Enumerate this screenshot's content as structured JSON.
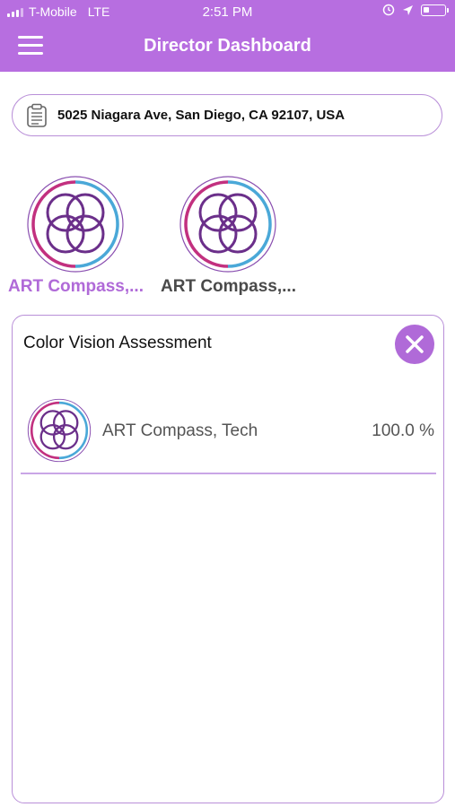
{
  "status_bar": {
    "carrier": "T-Mobile",
    "network": "LTE",
    "time": "2:51 PM",
    "icons": [
      "signal-icon",
      "alarm-icon",
      "location-icon",
      "battery-icon"
    ]
  },
  "header": {
    "title": "Director Dashboard",
    "menu_icon": "hamburger-menu-icon",
    "background_color": "#b76ee0"
  },
  "address": {
    "text": "5025 Niagara Ave, San Diego, CA 92107, USA",
    "icon": "clipboard-icon"
  },
  "entities": [
    {
      "label": "ART Compass,...",
      "selected": true,
      "icon": "art-compass-logo-icon"
    },
    {
      "label": "ART Compass,...",
      "selected": false,
      "icon": "art-compass-logo-icon"
    }
  ],
  "panel": {
    "title": "Color Vision Assessment",
    "close_icon": "close-icon",
    "rows": [
      {
        "label": "ART Compass, Tech",
        "value": "100.0 %",
        "icon": "art-compass-logo-icon"
      }
    ]
  },
  "colors": {
    "accent": "#b06ad8",
    "border": "#b98fd8",
    "logo_purple": "#6b2f8a",
    "logo_magenta": "#c2307f",
    "logo_blue": "#4aa8d8"
  }
}
